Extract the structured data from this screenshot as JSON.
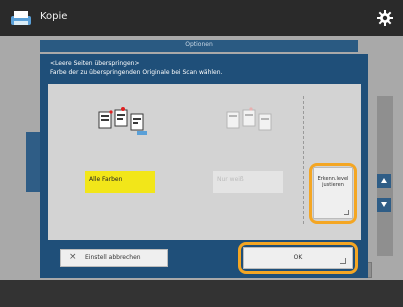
{
  "header": {
    "app_title": "Kopie",
    "app_icon": "copy-icon",
    "settings_icon": "gear-icon"
  },
  "background": {
    "band_text": "Optionen"
  },
  "dialog": {
    "line1": "<Leere Seiten überspringen>",
    "line2": "Farbe der zu überspringenden Originale bei Scan wählen.",
    "options": [
      {
        "label": "Alle Farben",
        "selected": true
      },
      {
        "label": "Nur weiß",
        "selected": false
      }
    ],
    "adjust_button": "Erkenn.level justieren",
    "cancel_button": "Einstell abbrechen",
    "ok_button": "OK"
  },
  "colors": {
    "accent_highlight": "#f4a623",
    "selected_option": "#f2e619",
    "dialog_blue": "#1f4f79"
  }
}
